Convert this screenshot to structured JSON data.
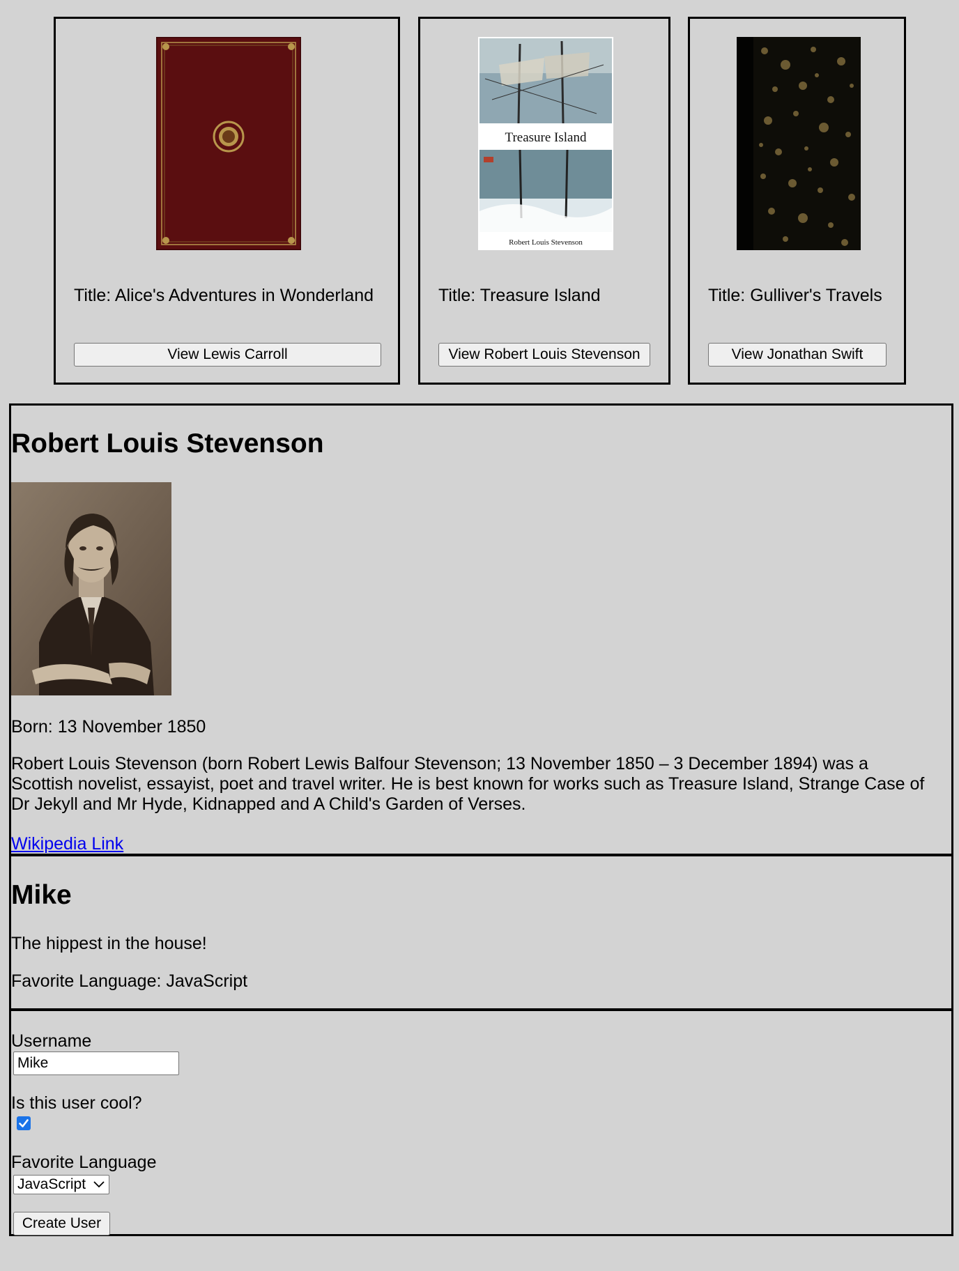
{
  "books": [
    {
      "title_label": "Title: Alice's Adventures in Wonderland",
      "button_label": "View Lewis Carroll",
      "cover_colors": {
        "base": "#5a0e10",
        "trim": "#b8964c"
      }
    },
    {
      "title_label": "Title: Treasure Island",
      "button_label": "View Robert Louis Stevenson",
      "cover_title": "Treasure Island",
      "cover_author": "Robert Louis Stevenson"
    },
    {
      "title_label": "Title: Gulliver's Travels",
      "button_label": "View Jonathan Swift",
      "cover_colors": {
        "base": "#0e0d08",
        "speckle": "#6b5a32"
      }
    }
  ],
  "author": {
    "name": "Robert Louis Stevenson",
    "born": "Born: 13 November 1850",
    "bio_line1": "Robert Louis Stevenson (born Robert Lewis Balfour Stevenson; 13 November 1850 – 3 December 1894) was a",
    "bio_line2": "Scottish novelist, essayist, poet and travel writer. He is best known for works such as Treasure Island, Strange Case of",
    "bio_line3": "Dr Jekyll and Mr Hyde, Kidnapped and A Child's Garden of Verses.",
    "link_label": "Wikipedia Link"
  },
  "user": {
    "name": "Mike",
    "tagline": "The hippest in the house!",
    "favorite_language": "Favorite Language: JavaScript"
  },
  "form": {
    "username_label": "Username",
    "username_value": "Mike",
    "cool_label": "Is this user cool?",
    "cool_checked": true,
    "language_label": "Favorite Language",
    "language_selected": "JavaScript",
    "submit_label": "Create User"
  },
  "colors": {
    "page_bg": "#d3d3d3",
    "link": "#0000ee",
    "checkbox_accent": "#1a73e8"
  },
  "icons": [
    "chevron-down-icon",
    "checkmark-icon"
  ]
}
